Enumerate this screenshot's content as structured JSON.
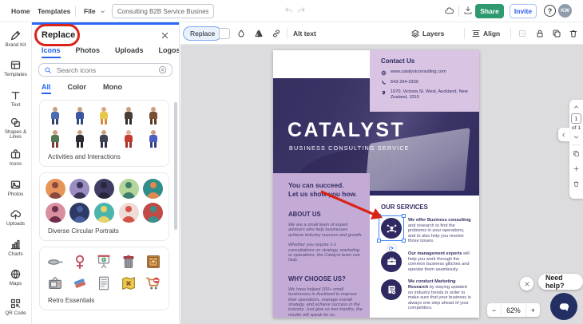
{
  "topnav": {
    "home": "Home",
    "templates": "Templates",
    "file": "File",
    "doc_title": "Consulting B2B Service Business ...",
    "share": "Share",
    "invite": "Invite",
    "help": "?",
    "avatar": "KW"
  },
  "sidebar": {
    "items": [
      {
        "id": "brand-kit",
        "label": "Brand Kit"
      },
      {
        "id": "templates",
        "label": "Templates"
      },
      {
        "id": "text",
        "label": "Text"
      },
      {
        "id": "shapes",
        "label": "Shapes & Lines"
      },
      {
        "id": "icons",
        "label": "Icons"
      },
      {
        "id": "photos",
        "label": "Photos"
      },
      {
        "id": "uploads",
        "label": "Uploads"
      },
      {
        "id": "charts",
        "label": "Charts"
      },
      {
        "id": "maps",
        "label": "Maps"
      },
      {
        "id": "qr",
        "label": "QR Code"
      }
    ]
  },
  "panel": {
    "title": "Replace",
    "tabs": [
      {
        "label": "Icons",
        "active": true
      },
      {
        "label": "Photos",
        "active": false
      },
      {
        "label": "Uploads",
        "active": false
      },
      {
        "label": "Logos",
        "active": false
      }
    ],
    "search_placeholder": "Search icons",
    "filters": [
      {
        "label": "All",
        "active": true
      },
      {
        "label": "Color",
        "active": false
      },
      {
        "label": "Mono",
        "active": false
      }
    ],
    "sections": [
      {
        "caption": "Activities and Interactions",
        "type": "people",
        "items": [
          {
            "skin": "#caa07e",
            "shirt": "#4b6cb0",
            "pants": "#35406b"
          },
          {
            "skin": "#caa07e",
            "shirt": "#3c56a0",
            "pants": "#32487f"
          },
          {
            "skin": "#d8a97e",
            "shirt": "#e8c84a",
            "pants": "#d98c3f"
          },
          {
            "skin": "#caa07e",
            "shirt": "#4a3f38",
            "pants": "#352b26"
          },
          {
            "skin": "#caa07e",
            "shirt": "#7a4f33",
            "pants": "#5e3b26"
          },
          {
            "skin": "#caa07e",
            "shirt": "#4f7a52",
            "pants": "#7a3b3b"
          },
          {
            "skin": "#caa07e",
            "shirt": "#2b2b33",
            "pants": "#22222a"
          },
          {
            "skin": "#caa07e",
            "shirt": "#3f4455",
            "pants": "#2e3242"
          },
          {
            "skin": "#e0b49a",
            "shirt": "#c43a35",
            "pants": "#a32e2a"
          },
          {
            "skin": "#caa07e",
            "shirt": "#4a5fc1",
            "pants": "#353f80"
          }
        ]
      },
      {
        "caption": "Diverse Circular Portraits",
        "type": "portraits",
        "items": [
          {
            "bg": "#e8935a",
            "fg": "#8a4a42"
          },
          {
            "bg": "#9b8cc2",
            "fg": "#3a3456"
          },
          {
            "bg": "#3f3d63",
            "fg": "#28263f"
          },
          {
            "bg": "#b5d69a",
            "fg": "#3f7d6e"
          },
          {
            "bg": "#2f8e8a",
            "fg": "#e08a4f"
          },
          {
            "bg": "#d98fa0",
            "fg": "#6e2f4a"
          },
          {
            "bg": "#2e3a66",
            "fg": "#4a5f9e"
          },
          {
            "bg": "#4ab5ad",
            "fg": "#e8d26a"
          },
          {
            "bg": "#f0dcd6",
            "fg": "#d4544a"
          },
          {
            "bg": "#c04a45",
            "fg": "#3f8e8a"
          }
        ]
      },
      {
        "caption": "Retro Essentials",
        "type": "retro",
        "items": [
          "frying-pan",
          "venus-symbol",
          "presentation-play",
          "trash-can",
          "crate-star",
          "tv-set",
          "eraser",
          "document",
          "treasure-map",
          "shopping-cart"
        ]
      }
    ]
  },
  "toolbar": {
    "replace": "Replace",
    "alt_text": "Alt text",
    "layers": "Layers",
    "align": "Align"
  },
  "flyer": {
    "contact": {
      "heading": "Contact Us",
      "rows": [
        {
          "icon": "globe",
          "text": "www.catalystconsulting.com"
        },
        {
          "icon": "phone",
          "text": "643-294-3330"
        },
        {
          "icon": "pin",
          "text": "1070, Victoria St. West, Auckland, New Zealand, 1010"
        }
      ]
    },
    "title": "CATALYST",
    "subtitle": "BUSINESS CONSULTING SERVICE",
    "tagline_1": "You can succeed.",
    "tagline_2": "Let us show you how.",
    "about": {
      "heading": "ABOUT US",
      "paras": [
        "We are a small team of expert advisors who help businesses achieve industry success and growth.",
        "Whether you require 1-1 consultations on strategy, marketing or operations, the Catalyst team can help."
      ]
    },
    "why": {
      "heading": "WHY CHOOSE US?",
      "para": "We have helped 200+ small businesses in Auckland to improve their operations, manage overall strategy, and achieve success in the industry. Just give us two months, the results will speak for us."
    },
    "services": {
      "heading": "OUR SERVICES",
      "items": [
        {
          "icon": "network",
          "lead": "We offer Business consulting",
          "rest": " and research to find the problems in your operations, and to also help you resolve those issues.",
          "selected": true
        },
        {
          "icon": "briefcase",
          "lead": "Our management experts",
          "rest": " will help you work through the common business glitches and operate them seamlessly.",
          "selected": false
        },
        {
          "icon": "report",
          "lead": "We conduct Marketing Research",
          "rest": " by staying updated on industry trends in order to make sure that your business is always one step ahead of your competitors.",
          "selected": false
        }
      ]
    }
  },
  "page_nav": {
    "page": "1",
    "of_label": "of 1"
  },
  "zoom_control": {
    "minus": "−",
    "value": "62%",
    "plus": "+"
  },
  "help_bubble": {
    "label": "Need help?"
  },
  "colors": {
    "accent_blue": "#2b66f6",
    "share_green": "#2e9a6e",
    "annotation_red": "#da2418",
    "flyer_navy": "#2e2960",
    "flyer_lavender_light": "#d9c4e4",
    "flyer_lavender": "#c4abd5"
  }
}
